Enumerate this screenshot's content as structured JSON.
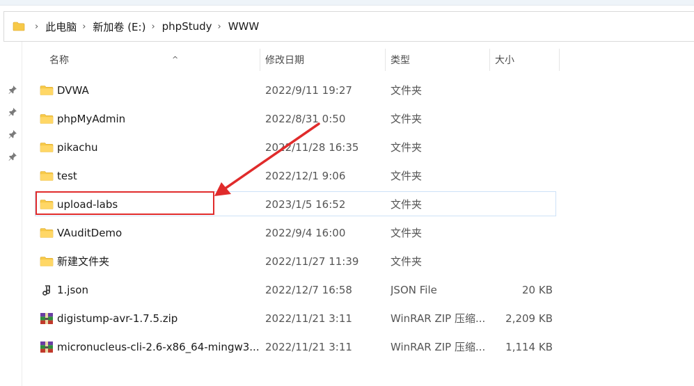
{
  "breadcrumb": {
    "items": [
      "此电脑",
      "新加卷 (E:)",
      "phpStudy",
      "WWW"
    ]
  },
  "columns": {
    "name": "名称",
    "date": "修改日期",
    "type": "类型",
    "size": "大小"
  },
  "files": [
    {
      "name": "DVWA",
      "date": "2022/9/11 19:27",
      "type": "文件夹",
      "size": "",
      "icon": "folder-icon"
    },
    {
      "name": "phpMyAdmin",
      "date": "2022/8/31 0:50",
      "type": "文件夹",
      "size": "",
      "icon": "folder-icon"
    },
    {
      "name": "pikachu",
      "date": "2022/11/28 16:35",
      "type": "文件夹",
      "size": "",
      "icon": "folder-icon"
    },
    {
      "name": "test",
      "date": "2022/12/1 9:06",
      "type": "文件夹",
      "size": "",
      "icon": "folder-icon"
    },
    {
      "name": "upload-labs",
      "date": "2023/1/5 16:52",
      "type": "文件夹",
      "size": "",
      "icon": "folder-icon"
    },
    {
      "name": "VAuditDemo",
      "date": "2022/9/4 16:00",
      "type": "文件夹",
      "size": "",
      "icon": "folder-icon"
    },
    {
      "name": "新建文件夹",
      "date": "2022/11/27 11:39",
      "type": "文件夹",
      "size": "",
      "icon": "folder-icon"
    },
    {
      "name": "1.json",
      "date": "2022/12/7 16:58",
      "type": "JSON File",
      "size": "20 KB",
      "icon": "json-file-icon"
    },
    {
      "name": "digistump-avr-1.7.5.zip",
      "date": "2022/11/21 3:11",
      "type": "WinRAR ZIP 压缩...",
      "size": "2,209 KB",
      "icon": "winrar-zip-icon"
    },
    {
      "name": "micronucleus-cli-2.6-x86_64-mingw3...",
      "date": "2022/11/21 3:11",
      "type": "WinRAR ZIP 压缩...",
      "size": "1,114 KB",
      "icon": "winrar-zip-icon"
    }
  ],
  "colors": {
    "folder": "#f7c948",
    "highlight": "#e02b2b",
    "selection_border": "#cde1f7"
  }
}
